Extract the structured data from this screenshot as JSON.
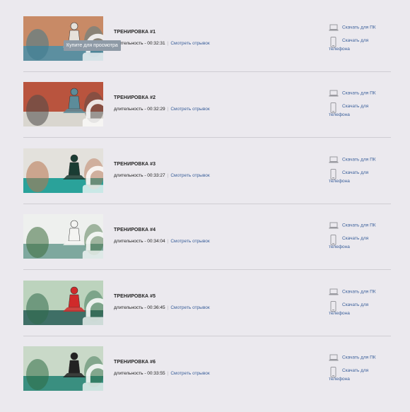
{
  "workouts": [
    {
      "title": "ТРЕНИРОВКА #1",
      "duration": "длительность - 00:32:31",
      "preview_link": "Смотреть отрывок",
      "download_pc": "Скачать для ПК",
      "download_phone_1": "Скачать для",
      "download_phone_2": "телефона",
      "tooltip": "Купите для просмотра",
      "palette": {
        "bg": "#c88a66",
        "floor": "#5c8fa0",
        "body": "#e6e1da",
        "accent": "#3f7a8c"
      }
    },
    {
      "title": "ТРЕНИРОВКА #2",
      "duration": "длительность - 00:32:29",
      "preview_link": "Смотреть отрывок",
      "download_pc": "Скачать для ПК",
      "download_phone_1": "Скачать для",
      "download_phone_2": "телефона",
      "palette": {
        "bg": "#b9543e",
        "floor": "#d9d6cf",
        "body": "#5c8c9a",
        "accent": "#4d4a48"
      }
    },
    {
      "title": "ТРЕНИРОВКА #3",
      "duration": "длительность - 00:33:27",
      "preview_link": "Смотреть отрывок",
      "download_pc": "Скачать для ПК",
      "download_phone_1": "Скачать для",
      "download_phone_2": "телефона",
      "palette": {
        "bg": "#e3e1dc",
        "floor": "#2aa29a",
        "body": "#1a3c33",
        "accent": "#b8744f"
      }
    },
    {
      "title": "ТРЕНИРОВКА #4",
      "duration": "длительность - 00:34:04",
      "preview_link": "Смотреть отрывок",
      "download_pc": "Скачать для ПК",
      "download_phone_1": "Скачать для",
      "download_phone_2": "телефона",
      "palette": {
        "bg": "#eef0ee",
        "floor": "#7ea89e",
        "body": "#f4f4f2",
        "accent": "#3d6b3c"
      }
    },
    {
      "title": "ТРЕНИРОВКА #5",
      "duration": "длительность - 00:36:45",
      "preview_link": "Смотреть отрывок",
      "download_pc": "Скачать для ПК",
      "download_phone_1": "Скачать для",
      "download_phone_2": "телефона",
      "palette": {
        "bg": "#bcd3bd",
        "floor": "#3f6f66",
        "body": "#d02a2a",
        "accent": "#2f6a4a"
      }
    },
    {
      "title": "ТРЕНИРОВКА #6",
      "duration": "длительность - 00:33:55",
      "preview_link": "Смотреть отрывок",
      "download_pc": "Скачать для ПК",
      "download_phone_1": "Скачать для",
      "download_phone_2": "телефона",
      "palette": {
        "bg": "#c9d9c8",
        "floor": "#3a8f80",
        "body": "#222222",
        "accent": "#2e6b44"
      }
    }
  ],
  "icons": {
    "laptop": "laptop-icon",
    "phone": "phone-icon",
    "lock": "lock-icon"
  }
}
